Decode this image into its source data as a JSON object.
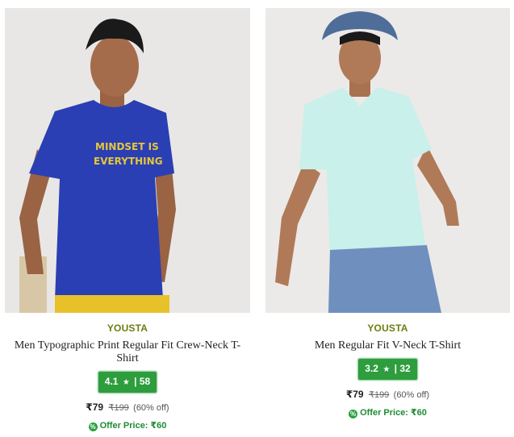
{
  "products": [
    {
      "brand": "YOUSTA",
      "title": "Men Typographic Print Regular Fit Crew-Neck T-Shirt",
      "rating": "4.1",
      "rating_star": "★",
      "rating_sep": "|",
      "review_count": "58",
      "price": "₹79",
      "mrp": "₹199",
      "discount": "(60% off)",
      "offer_label": "Offer Price: ₹60",
      "image_print_text": "MINDSET IS EVERYTHING",
      "tshirt_color": "#2a3fb3",
      "shorts_color": "#e8c12a"
    },
    {
      "brand": "YOUSTA",
      "title": "Men Regular Fit V-Neck T-Shirt",
      "rating": "3.2",
      "rating_star": "★",
      "rating_sep": "|",
      "review_count": "32",
      "price": "₹79",
      "mrp": "₹199",
      "discount": "(60% off)",
      "offer_label": "Offer Price: ₹60",
      "tshirt_color": "#c9f0ea",
      "jeans_color": "#6f8fbf"
    }
  ]
}
